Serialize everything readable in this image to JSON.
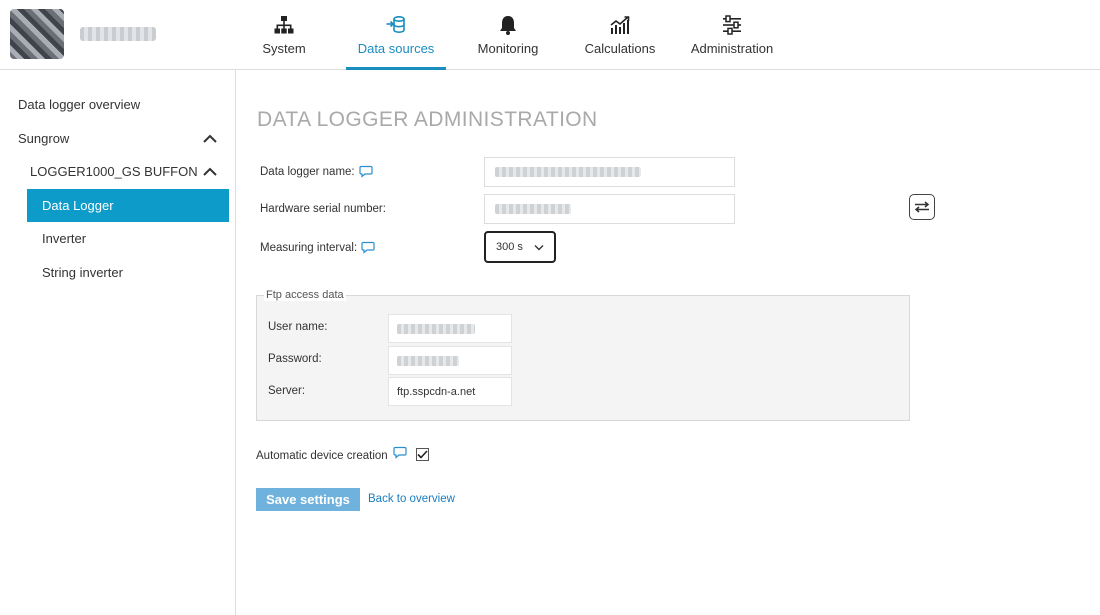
{
  "header": {
    "nav": [
      {
        "label": "System",
        "icon": "sitemap-icon"
      },
      {
        "label": "Data sources",
        "icon": "database-import-icon",
        "active": true
      },
      {
        "label": "Monitoring",
        "icon": "bell-icon"
      },
      {
        "label": "Calculations",
        "icon": "chart-line-icon"
      },
      {
        "label": "Administration",
        "icon": "sliders-icon"
      }
    ]
  },
  "sidebar": {
    "items": [
      {
        "label": "Data logger overview"
      },
      {
        "label": "Sungrow",
        "expanded": true
      },
      {
        "label": "LOGGER1000_GS BUFFON",
        "expanded": true
      },
      {
        "label": "Data Logger",
        "active": true
      },
      {
        "label": "Inverter"
      },
      {
        "label": "String inverter"
      }
    ]
  },
  "main": {
    "title": "DATA LOGGER ADMINISTRATION",
    "fields": {
      "name_label": "Data logger name:",
      "serial_label": "Hardware serial number:",
      "interval_label": "Measuring interval:",
      "interval_value": "300 s"
    },
    "ftp": {
      "legend": "Ftp access data",
      "user_label": "User name:",
      "password_label": "Password:",
      "server_label": "Server:",
      "server_value": "ftp.sspcdn-a.net"
    },
    "auto_creation_label": "Automatic device creation",
    "auto_creation_checked": true,
    "save_label": "Save settings",
    "back_label": "Back to overview"
  },
  "colors": {
    "accent": "#1a8dc0",
    "active_sidebar": "#0d9bc9",
    "save_button": "#6eb2dd"
  }
}
